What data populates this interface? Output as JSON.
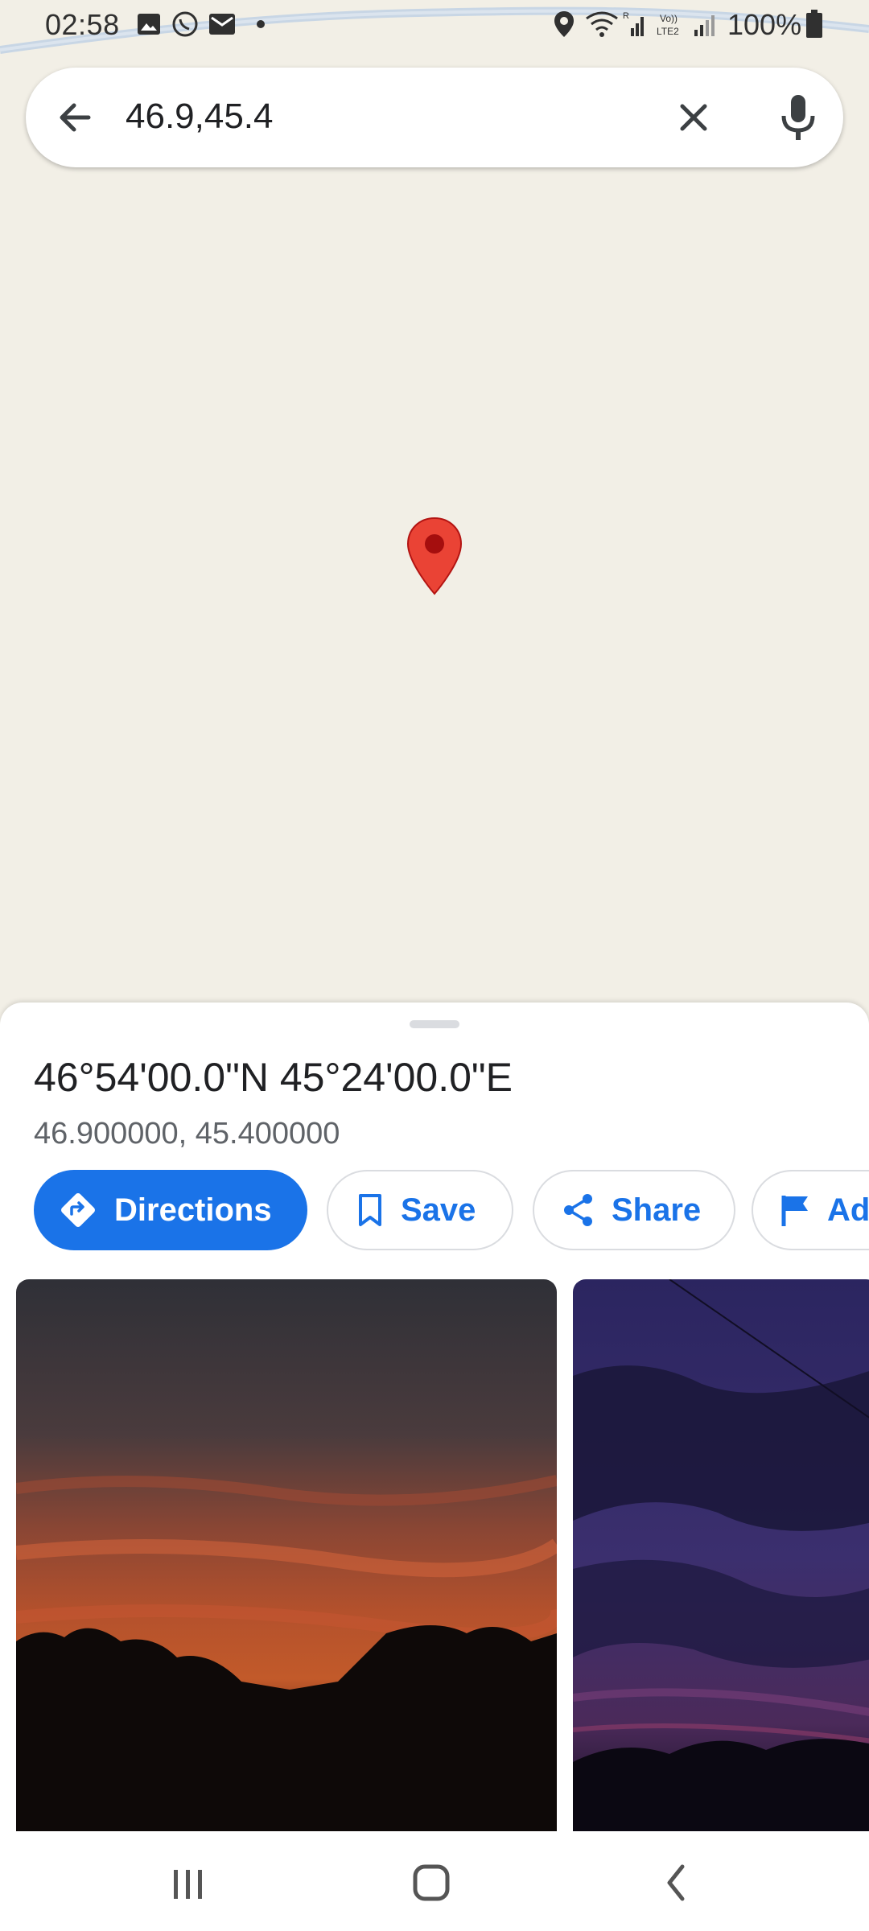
{
  "status_bar": {
    "time": "02:58",
    "battery": "100%",
    "icons": [
      "gallery-icon",
      "whatsapp-icon",
      "mail-icon",
      "dot-icon",
      "location-icon",
      "wifi-icon",
      "signal-icon",
      "volte-lte2-icon",
      "signal2-icon",
      "battery-icon"
    ]
  },
  "search": {
    "query": "46.9,45.4",
    "back_icon": "arrow-back-icon",
    "clear_icon": "close-icon",
    "mic_icon": "mic-icon"
  },
  "map": {
    "pin_icon": "map-pin-icon",
    "pin_color": "#ea4335",
    "background_color": "#f2efe6"
  },
  "place": {
    "title": "46°54'00.0\"N 45°24'00.0\"E",
    "coordinates": "46.900000, 45.400000"
  },
  "actions": {
    "directions": "Directions",
    "save": "Save",
    "share": "Share",
    "add": "Ad"
  },
  "colors": {
    "accent": "#1a73e8"
  },
  "photos": [
    {
      "name": "sunset-photo"
    },
    {
      "name": "night-sky-photo"
    }
  ],
  "navbar": {
    "recents_icon": "recents-icon",
    "home_icon": "home-icon",
    "back_icon": "nav-back-icon"
  }
}
